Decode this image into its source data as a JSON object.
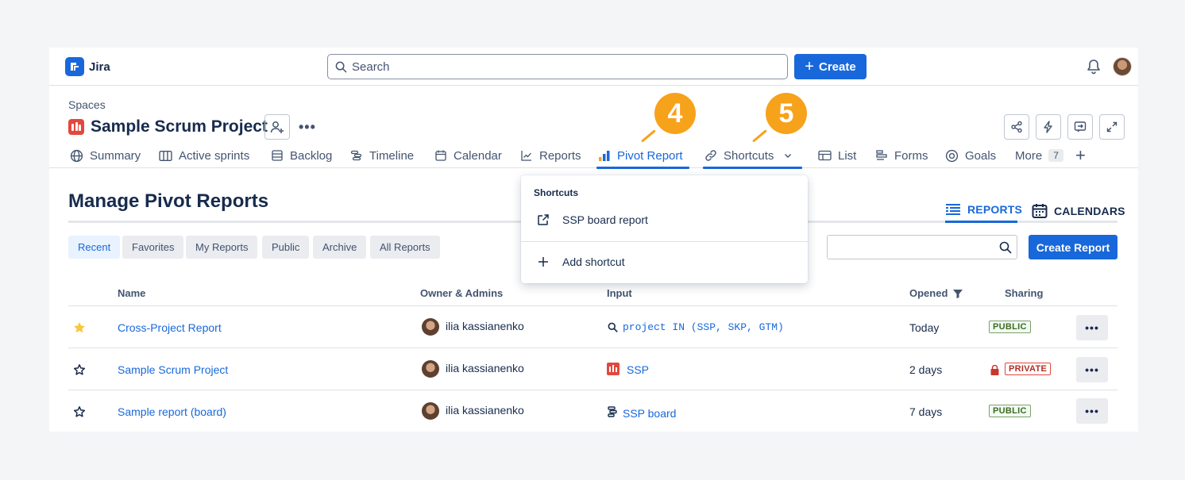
{
  "app": {
    "name": "Jira"
  },
  "search": {
    "placeholder": "Search"
  },
  "top": {
    "create_label": "Create"
  },
  "header": {
    "breadcrumb": "Spaces",
    "project_title": "Sample Scrum Project"
  },
  "tabs": [
    {
      "label": "Summary",
      "icon": "globe-icon"
    },
    {
      "label": "Active sprints",
      "icon": "board-icon"
    },
    {
      "label": "Backlog",
      "icon": "list-icon"
    },
    {
      "label": "Timeline",
      "icon": "timeline-icon"
    },
    {
      "label": "Calendar",
      "icon": "calendar-icon"
    },
    {
      "label": "Reports",
      "icon": "chart-line-icon"
    },
    {
      "label": "Pivot Report",
      "icon": "bar-chart-icon",
      "active": true
    },
    {
      "label": "Shortcuts",
      "icon": "link-icon"
    },
    {
      "label": "List",
      "icon": "table-icon"
    },
    {
      "label": "Forms",
      "icon": "form-icon"
    },
    {
      "label": "Goals",
      "icon": "target-icon"
    },
    {
      "label": "More",
      "count": "7"
    }
  ],
  "callouts": [
    "4",
    "5"
  ],
  "page": {
    "title": "Manage Pivot Reports"
  },
  "views": {
    "reports": "REPORTS",
    "calendars": "CALENDARS"
  },
  "filters": [
    "Recent",
    "Favorites",
    "My Reports",
    "Public",
    "Archive",
    "All Reports"
  ],
  "create_report": "Create Report",
  "table": {
    "headers": {
      "name": "Name",
      "owner": "Owner & Admins",
      "input": "Input",
      "opened": "Opened",
      "sharing": "Sharing"
    },
    "rows": [
      {
        "starred": true,
        "name": "Cross-Project Report",
        "owner": "ilia kassianenko",
        "input": "project IN (SSP, SKP, GTM)",
        "input_type": "jql",
        "opened": "Today",
        "sharing": "PUBLIC"
      },
      {
        "starred": false,
        "name": "Sample Scrum Project",
        "owner": "ilia kassianenko",
        "input": "SSP",
        "input_type": "project",
        "opened": "2 days",
        "sharing": "PRIVATE"
      },
      {
        "starred": false,
        "name": "Sample report (board)",
        "owner": "ilia kassianenko",
        "input": "SSP board",
        "input_type": "board",
        "opened": "7 days",
        "sharing": "PUBLIC"
      }
    ]
  },
  "dropdown": {
    "heading": "Shortcuts",
    "items": [
      "SSP board report",
      "Add shortcut"
    ]
  },
  "colors": {
    "brand": "#1868db",
    "callout": "#f7a21b",
    "project": "#e2483d"
  }
}
